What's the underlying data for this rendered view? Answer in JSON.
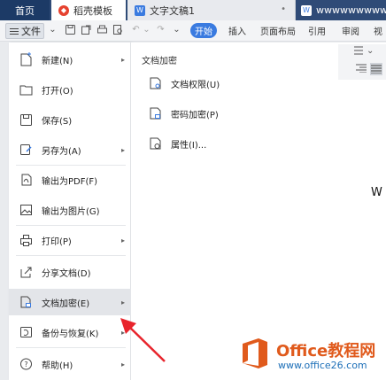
{
  "tabs": {
    "home": "首页",
    "template": "稻壳模板",
    "document": "文字文稿1",
    "document_icon": "W",
    "document_close": "•",
    "www": "wwwwwwwww"
  },
  "toolbar": {
    "file_label": "文件",
    "ribbon_active": "开始",
    "ribbon_tabs": [
      "插入",
      "页面布局",
      "引用",
      "审阅",
      "视"
    ]
  },
  "file_menu": {
    "items": [
      {
        "label": "新建(N)",
        "icon": "new-doc-icon",
        "has_submenu": true
      },
      {
        "label": "打开(O)",
        "icon": "folder-open-icon",
        "has_submenu": false
      },
      {
        "label": "保存(S)",
        "icon": "save-icon",
        "has_submenu": false
      },
      {
        "label": "另存为(A)",
        "icon": "save-as-icon",
        "has_submenu": true
      },
      {
        "label": "输出为PDF(F)",
        "icon": "pdf-export-icon",
        "has_submenu": false
      },
      {
        "label": "输出为图片(G)",
        "icon": "image-export-icon",
        "has_submenu": false
      },
      {
        "label": "打印(P)",
        "icon": "printer-icon",
        "has_submenu": true
      },
      {
        "label": "分享文档(D)",
        "icon": "share-icon",
        "has_submenu": false
      },
      {
        "label": "文档加密(E)",
        "icon": "encrypt-icon",
        "has_submenu": true,
        "active": true
      },
      {
        "label": "备份与恢复(K)",
        "icon": "backup-icon",
        "has_submenu": true
      },
      {
        "label": "帮助(H)",
        "icon": "help-icon",
        "has_submenu": true
      }
    ]
  },
  "submenu": {
    "title": "文档加密",
    "items": [
      {
        "label": "文档权限(U)",
        "icon": "doc-permission-icon"
      },
      {
        "label": "密码加密(P)",
        "icon": "password-encrypt-icon"
      },
      {
        "label": "属性(I)...",
        "icon": "properties-icon"
      }
    ]
  },
  "document": {
    "visible_text": "W"
  },
  "watermark": {
    "brand": "Office教程网",
    "url": "www.office26.com"
  },
  "colors": {
    "tabbar": "#2f4b77",
    "accent": "#3a7be0",
    "arrow": "#e8242c",
    "brand_orange": "#e05a1c",
    "url_blue": "#1d6fb8"
  }
}
